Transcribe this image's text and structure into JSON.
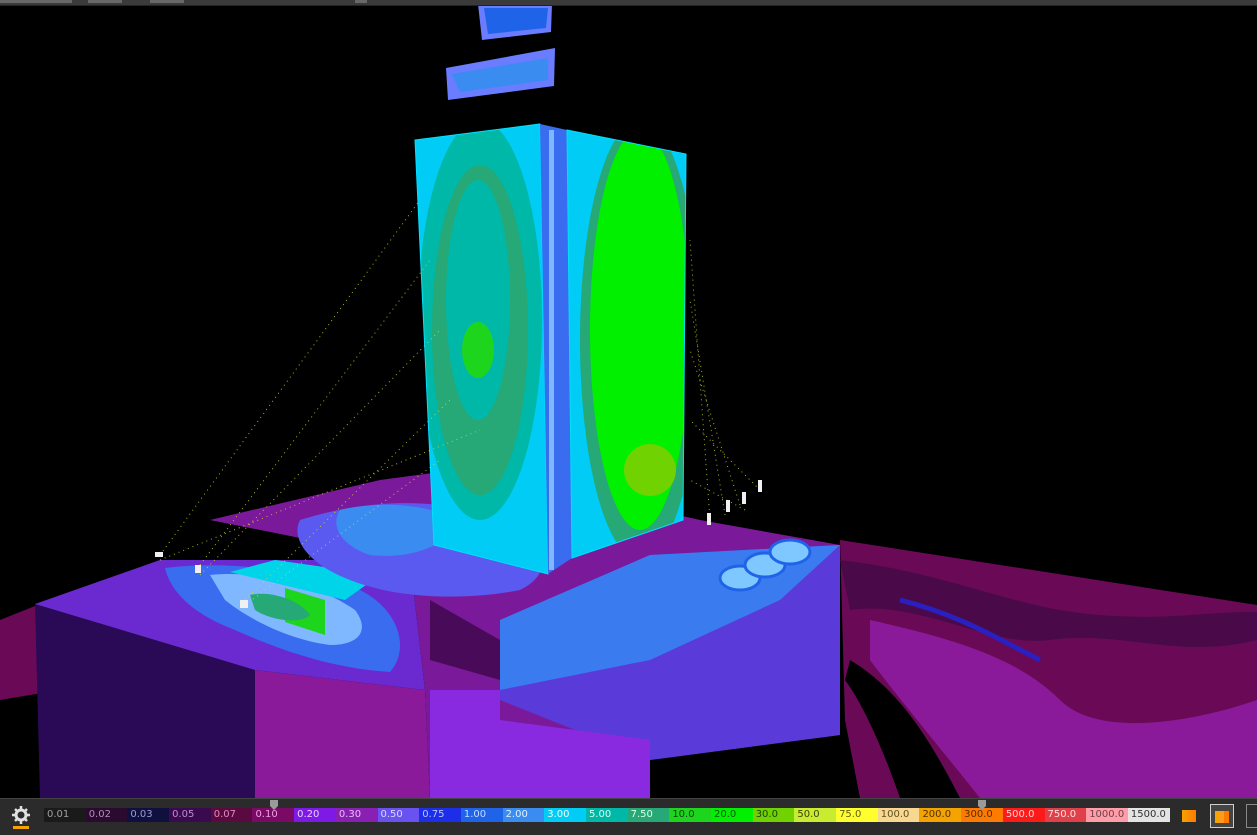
{
  "viewport": {
    "name": "3D illuminance false-color view",
    "background": "#000000"
  },
  "settings": {
    "icon": "gear-icon"
  },
  "legend": {
    "segments": [
      {
        "label": "0.01",
        "color": "#1a1a1a",
        "text": "#a0a0a0"
      },
      {
        "label": "0.02",
        "color": "#2a0a2e",
        "text": "#b48ab8"
      },
      {
        "label": "0.03",
        "color": "#10103e",
        "text": "#9a9ad8"
      },
      {
        "label": "0.05",
        "color": "#3a0a4e",
        "text": "#c08ad0"
      },
      {
        "label": "0.07",
        "color": "#5a0a40",
        "text": "#e08ac0"
      },
      {
        "label": "0.10",
        "color": "#7a0a66",
        "text": "#f0a0e0"
      },
      {
        "label": "0.20",
        "color": "#7f1ae6",
        "text": "#e6d0ff"
      },
      {
        "label": "0.30",
        "color": "#8a1fb3",
        "text": "#e8c0f0"
      },
      {
        "label": "0.50",
        "color": "#6a52f0",
        "text": "#dcd8ff"
      },
      {
        "label": "0.75",
        "color": "#1c2ee8",
        "text": "#bcc4ff"
      },
      {
        "label": "1.00",
        "color": "#1f63e8",
        "text": "#c8dcff"
      },
      {
        "label": "2.00",
        "color": "#3a8cf0",
        "text": "#e0f0ff"
      },
      {
        "label": "3.00",
        "color": "#00ccf5",
        "text": "#e8ffff"
      },
      {
        "label": "5.00",
        "color": "#00b8a8",
        "text": "#d8fff0"
      },
      {
        "label": "7.50",
        "color": "#26a877",
        "text": "#e0ffe8"
      },
      {
        "label": "10.0",
        "color": "#1ed51e",
        "text": "#104010"
      },
      {
        "label": "20.0",
        "color": "#00f000",
        "text": "#105010"
      },
      {
        "label": "30.0",
        "color": "#70d200",
        "text": "#204010"
      },
      {
        "label": "50.0",
        "color": "#c8ec30",
        "text": "#404010"
      },
      {
        "label": "75.0",
        "color": "#ffff30",
        "text": "#606010"
      },
      {
        "label": "100.0",
        "color": "#f8d890",
        "text": "#605020"
      },
      {
        "label": "200.0",
        "color": "#f5a300",
        "text": "#503000"
      },
      {
        "label": "300.0",
        "color": "#ff7a00",
        "text": "#503000"
      },
      {
        "label": "500.0",
        "color": "#ff1a1a",
        "text": "#ffd0d0"
      },
      {
        "label": "750.0",
        "color": "#e0404a",
        "text": "#ffe0e0"
      },
      {
        "label": "1000.0",
        "color": "#ff9da8",
        "text": "#704048"
      },
      {
        "label": "1500.0",
        "color": "#e4e4e4",
        "text": "#303030"
      }
    ],
    "range_min": "0.10",
    "range_max": "300.0"
  },
  "view_modes": [
    {
      "name": "gradient-mode-button",
      "active": false
    },
    {
      "name": "stepped-mode-button",
      "active": true
    }
  ]
}
